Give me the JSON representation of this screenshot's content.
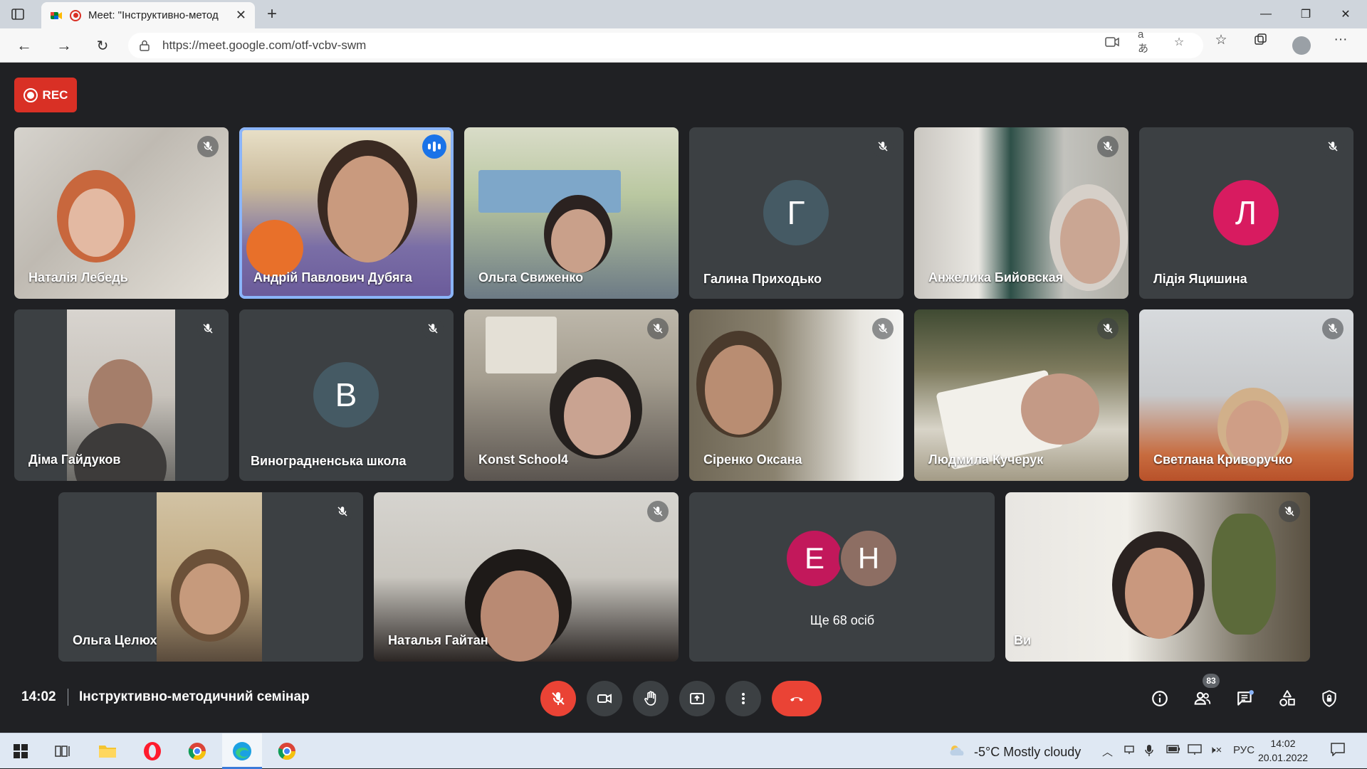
{
  "browser": {
    "tab_title": "Meet: \"Інструктивно-метод",
    "url": "https://meet.google.com/otf-vcbv-swm"
  },
  "rec_label": "REC",
  "participants": {
    "p1": "Наталія Лебедь",
    "p2": "Андрій Павлович Дубяга",
    "p3": "Ольга Свиженко",
    "p4": "Галина Приходько",
    "p4_initial": "Г",
    "p5": "Анжелика Бийовская",
    "p6": "Лідія Яцишина",
    "p6_initial": "Л",
    "p7": "Діма Гайдуков",
    "p8": "Виноградненська школа",
    "p8_initial": "В",
    "p9": "Konst School4",
    "p10": "Сіренко Оксана",
    "p11": "Людмила Кучерук",
    "p12": "Светлана Криворучко",
    "p13": "Ольга Целюх",
    "p14": "Наталья Гайтан",
    "p15": "Ви",
    "more_initial_1": "Е",
    "more_initial_2": "Н",
    "more_label": "Ще 68 осіб"
  },
  "meeting": {
    "time": "14:02",
    "title": "Інструктивно-методичний семінар",
    "participant_count": "83"
  },
  "taskbar": {
    "weather": "-5°C  Mostly cloudy",
    "lang": "РУС",
    "time": "14:02",
    "date": "20.01.2022"
  },
  "colors": {
    "accent_blue": "#1a73e8",
    "rec_red": "#d93025",
    "leave_red": "#ea4335",
    "tile_bg": "#3c4043",
    "meet_bg": "#202124"
  }
}
